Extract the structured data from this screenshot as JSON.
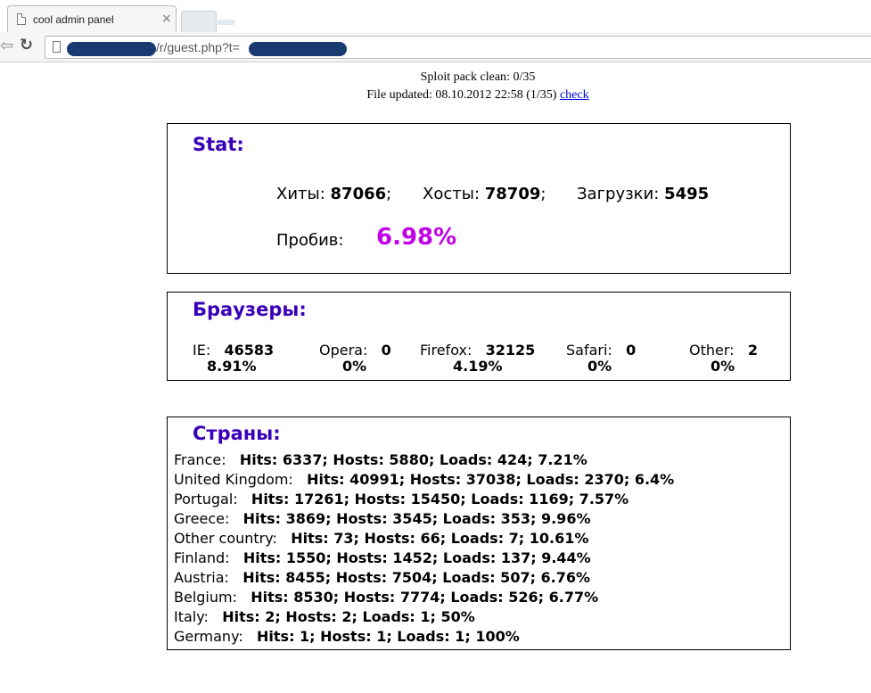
{
  "browser": {
    "tab_title": "cool admin panel",
    "tab_close": "×",
    "back_glyph": "⇦",
    "reload_glyph": "↻",
    "url_visible": "/r/guest.php?t="
  },
  "header": {
    "sploit_line": "Sploit pack clean: 0/35",
    "file_updated_line": "File updated: 08.10.2012 22:58 (1/35)",
    "check_link": "check"
  },
  "stat": {
    "title": "Stat:",
    "hits_label": "Хиты:",
    "hits_value": "87066",
    "hosts_label": "Хосты:",
    "hosts_value": "78709",
    "loads_label": "Загрузки:",
    "loads_value": "5495",
    "sep": ";",
    "probiv_label": "Пробив:",
    "probiv_value": "6.98%"
  },
  "browsers": {
    "title": "Браузеры:",
    "items": [
      {
        "name": "IE:",
        "value": "46583",
        "percent": "8.91%"
      },
      {
        "name": "Opera:",
        "value": "0",
        "percent": "0%"
      },
      {
        "name": "Firefox:",
        "value": "32125",
        "percent": "4.19%"
      },
      {
        "name": "Safari:",
        "value": "0",
        "percent": "0%"
      },
      {
        "name": "Other:",
        "value": "2",
        "percent": "0%"
      }
    ]
  },
  "countries": {
    "title": "Страны:",
    "rows": [
      {
        "name": "France:",
        "stats": "Hits: 6337; Hosts: 5880; Loads: 424; 7.21%"
      },
      {
        "name": "United Kingdom:",
        "stats": "Hits: 40991; Hosts: 37038; Loads: 2370; 6.4%"
      },
      {
        "name": "Portugal:",
        "stats": "Hits: 17261; Hosts: 15450; Loads: 1169; 7.57%"
      },
      {
        "name": "Greece:",
        "stats": "Hits: 3869; Hosts: 3545; Loads: 353; 9.96%"
      },
      {
        "name": "Other country:",
        "stats": "Hits: 73; Hosts: 66; Loads: 7; 10.61%"
      },
      {
        "name": "Finland:",
        "stats": "Hits: 1550; Hosts: 1452; Loads: 137; 9.44%"
      },
      {
        "name": "Austria:",
        "stats": "Hits: 8455; Hosts: 7504; Loads: 507; 6.76%"
      },
      {
        "name": "Belgium:",
        "stats": "Hits: 8530; Hosts: 7774; Loads: 526; 6.77%"
      },
      {
        "name": "Italy:",
        "stats": "Hits: 2; Hosts: 2; Loads: 1; 50%"
      },
      {
        "name": "Germany:",
        "stats": "Hits: 1; Hosts: 1; Loads: 1; 100%"
      }
    ]
  },
  "colors": {
    "title": "#3a00b8",
    "probiv": "#c000e8",
    "link": "#0000ee",
    "redaction": "#1a3a72"
  }
}
